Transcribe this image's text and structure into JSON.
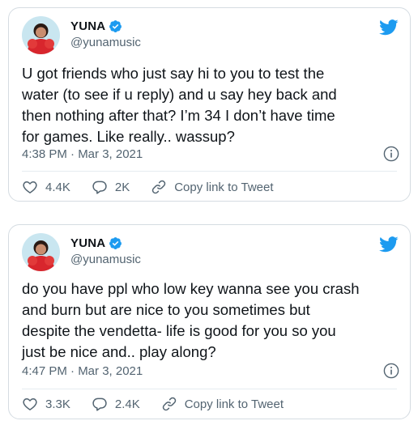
{
  "tweets": [
    {
      "name": "YUNA",
      "handle": "@yunamusic",
      "text": "U got friends who just say hi to you to test the\nwater (to see if u reply) and u say hey back and\nthen nothing after that? I’m 34 I don’t have time\nfor games. Like really.. wassup?",
      "meta": "4:38 PM · Mar 3, 2021",
      "likes": "4.4K",
      "replies": "2K",
      "copy_label": "Copy link to Tweet"
    },
    {
      "name": "YUNA",
      "handle": "@yunamusic",
      "text": "do you have ppl who low key wanna see you crash\nand burn but are nice to you sometimes but\ndespite the vendetta-  life is good for you so you\njust be nice and.. play along?",
      "meta": "4:47 PM · Mar 3, 2021",
      "likes": "3.3K",
      "replies": "2.4K",
      "copy_label": "Copy link to Tweet"
    }
  ],
  "colors": {
    "twitter_blue": "#1d9bf0",
    "secondary_text": "#536471",
    "border": "#d5dce2"
  },
  "icons": [
    "verified-badge-icon",
    "twitter-bird-icon",
    "info-icon",
    "heart-icon",
    "reply-icon",
    "link-icon"
  ]
}
